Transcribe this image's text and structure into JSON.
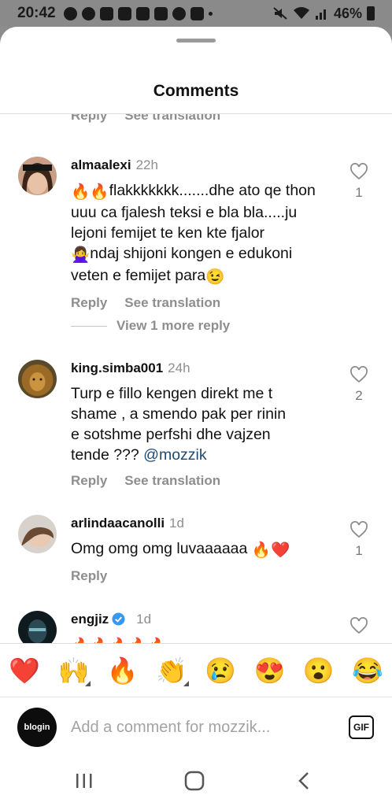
{
  "status_bar": {
    "time": "20:42",
    "battery": "46%"
  },
  "sheet": {
    "title": "Comments"
  },
  "partial_actions": {
    "reply": "Reply",
    "see_translation": "See translation"
  },
  "comments": [
    {
      "username": "almaalexi",
      "time": "22h",
      "text_lines": [
        "flakkkkkkk.......dhe ato qe thon",
        "uuu ca fjalesh teksi e bla bla.....ju",
        "lejoni femijet te ken kte fjalor",
        "ndaj shijoni kongen e edukoni",
        "veten e femijet para"
      ],
      "reply": "Reply",
      "see_translation": "See translation",
      "likes": "1",
      "view_more": "View 1 more reply"
    },
    {
      "username": "king.simba001",
      "time": "24h",
      "text_lines": [
        "Turp e fillo kengen direkt me t",
        "shame , a smendo pak per rinin",
        "e sotshme perfshi dhe vajzen",
        "tende ??? "
      ],
      "mention": "@mozzik",
      "reply": "Reply",
      "see_translation": "See translation",
      "likes": "2"
    },
    {
      "username": "arlindaacanolli",
      "time": "1d",
      "text": "Omg omg omg luvaaaaaa ",
      "reply": "Reply",
      "likes": "1"
    },
    {
      "username": "engjiz",
      "time": "1d",
      "verified": true
    }
  ],
  "emoji_bar": [
    "❤️",
    "🙌",
    "🔥",
    "👏",
    "😢",
    "😍",
    "😮",
    "😂"
  ],
  "composer": {
    "avatar_label": "blogin",
    "placeholder": "Add a comment for mozzik...",
    "gif_label": "GIF"
  }
}
